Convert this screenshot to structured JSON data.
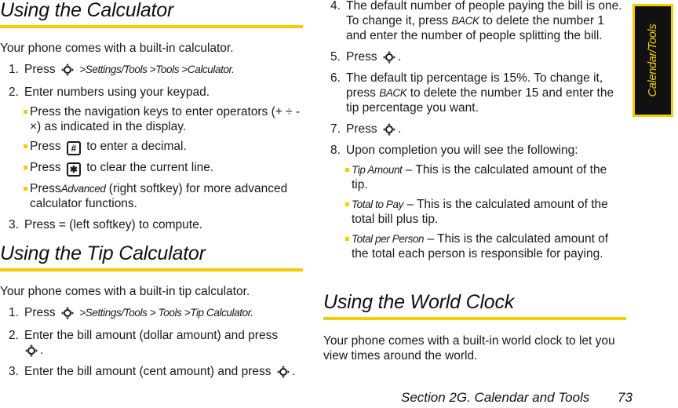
{
  "side_tab": {
    "label": "Calendar/Tools"
  },
  "sections": {
    "calculator": {
      "title": "Using the Calculator",
      "intro": "Your phone comes with a built-in calculator.",
      "steps": [
        {
          "num": "1.",
          "pre": "Press",
          "path": ">Settings/Tools >Tools >Calculator."
        },
        {
          "num": "2.",
          "text": "Enter numbers using your keypad."
        },
        {
          "num": "3.",
          "text": "Press = (left softkey) to compute."
        }
      ],
      "bullets": [
        {
          "text": "Press the navigation keys to enter operators (+ ÷ - ×) as indicated in the display."
        },
        {
          "pre": "Press",
          "key": "#",
          "post": "to enter a decimal."
        },
        {
          "pre": "Press",
          "key": "✱",
          "post": "to clear the current line."
        },
        {
          "pre": "Press",
          "ital": "Advanced",
          "post": "(right softkey) for more advanced calculator functions."
        }
      ]
    },
    "tip": {
      "title": "Using the Tip Calculator",
      "intro": "Your phone comes with a built-in tip calculator.",
      "steps": [
        {
          "num": "1.",
          "pre": "Press",
          "path": ">Settings/Tools > Tools >Tip Calculator."
        },
        {
          "num": "2.",
          "text": "Enter the bill amount (dollar amount) and press"
        },
        {
          "num": "3.",
          "text": "Enter the bill amount (cent amount) and press"
        },
        {
          "num": "4.",
          "a": "The default number of people paying the bill is one. To change it, press",
          "ital": "BACK",
          "b": "to delete the number 1 and enter the number of people splitting the bill."
        },
        {
          "num": "5.",
          "text": "Press"
        },
        {
          "num": "6.",
          "a": "The default tip percentage is 15%. To change it, press",
          "ital": "BACK",
          "b": "to delete the number 15 and enter the tip percentage you want."
        },
        {
          "num": "7.",
          "text": "Press"
        },
        {
          "num": "8.",
          "text": "Upon completion you will see the following:"
        }
      ],
      "results": [
        {
          "ital": "Tip Amount",
          "text": "– This is the calculated amount of the tip."
        },
        {
          "ital": "Total to Pay",
          "text": "– This is the calculated amount of the total bill plus tip."
        },
        {
          "ital": "Total per Person",
          "text": "– This is the calculated amount of the total each person is responsible for paying."
        }
      ]
    },
    "world_clock": {
      "title": "Using the World Clock",
      "intro": "Your phone comes with a built-in world clock to let you view times around the world."
    }
  },
  "footer": {
    "section": "Section 2G. Calendar and Tools",
    "page": "73"
  },
  "colors": {
    "accent": "#f5cd00",
    "tab_bg": "#111111"
  }
}
